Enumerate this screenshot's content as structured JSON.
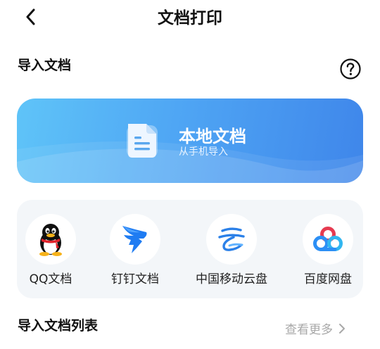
{
  "header": {
    "title": "文档打印",
    "back_icon": "back-arrow-icon"
  },
  "import_section": {
    "title": "导入文档",
    "help_icon": "help-question-icon"
  },
  "local_card": {
    "title": "本地文档",
    "subtitle": "从手机导入",
    "icon": "document-icon",
    "colors": {
      "start": "#5fc4f8",
      "end": "#3f86ea"
    }
  },
  "sources": [
    {
      "label": "QQ文档",
      "icon": "qq-penguin-icon"
    },
    {
      "label": "钉钉文档",
      "icon": "dingtalk-icon"
    },
    {
      "label": "中国移动云盘",
      "icon": "china-mobile-cloud-icon"
    },
    {
      "label": "百度网盘",
      "icon": "baidu-netdisk-icon"
    }
  ],
  "list_section": {
    "title": "导入文档列表",
    "more_label": "查看更多"
  }
}
